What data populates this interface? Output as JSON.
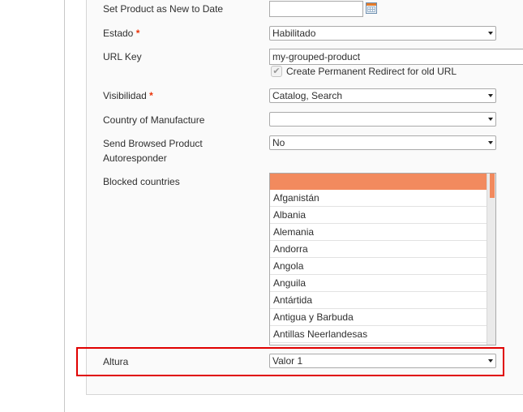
{
  "form": {
    "new_to_date": {
      "label": "Set Product as New to Date",
      "value": ""
    },
    "estado": {
      "label": "Estado",
      "required_mark": "*",
      "value": "Habilitado"
    },
    "url_key": {
      "label": "URL Key",
      "value": "my-grouped-product",
      "redirect_checkbox": {
        "label": "Create Permanent Redirect for old URL",
        "checked": true,
        "check_glyph": "✔"
      }
    },
    "visibilidad": {
      "label": "Visibilidad",
      "required_mark": "*",
      "value": "Catalog, Search"
    },
    "country_of_manufacture": {
      "label": "Country of Manufacture",
      "value": ""
    },
    "browsed_autoresponder": {
      "label_line1": "Send Browsed Product",
      "label_line2": "Autoresponder",
      "value": "No"
    },
    "blocked_countries": {
      "label": "Blocked countries",
      "options": [
        "",
        "Afganistán",
        "Albania",
        "Alemania",
        "Andorra",
        "Angola",
        "Anguila",
        "Antártida",
        "Antigua y Barbuda",
        "Antillas Neerlandesas"
      ]
    },
    "altura": {
      "label": "Altura",
      "value": "Valor 1"
    }
  },
  "colors": {
    "required": "#eb340a",
    "selected_option": "#f28a5e",
    "highlight_border": "#e00000"
  }
}
